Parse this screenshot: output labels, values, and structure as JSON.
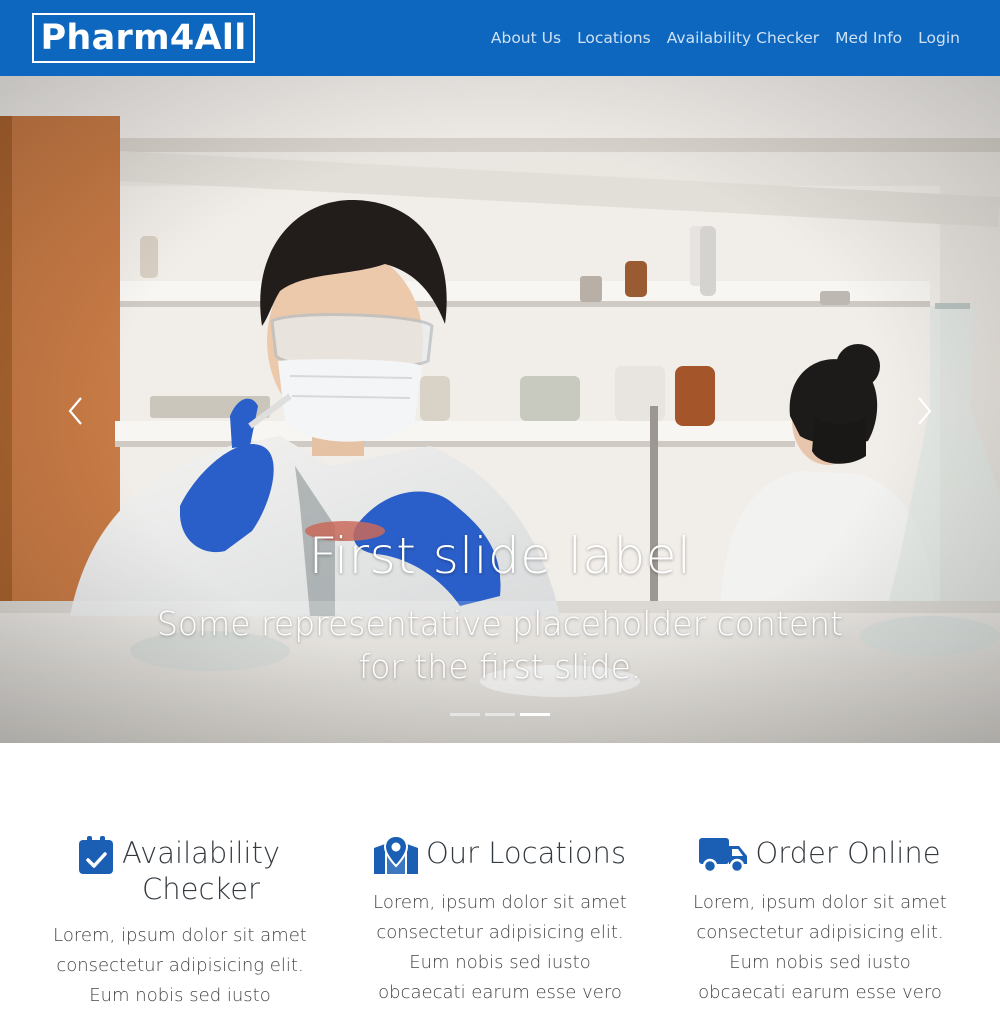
{
  "nav": {
    "brand": "Pharm4All",
    "links": [
      {
        "label": "About Us"
      },
      {
        "label": "Locations"
      },
      {
        "label": "Availability Checker"
      },
      {
        "label": "Med Info"
      },
      {
        "label": "Login"
      }
    ],
    "bg_color": "#0d67bf"
  },
  "carousel": {
    "slide_title": "First slide label",
    "slide_text": "Some representative placeholder content for the first slide.",
    "indicator_count": 3,
    "active_indicator": 3,
    "prev_icon": "chevron-left-icon",
    "next_icon": "chevron-right-icon"
  },
  "features": [
    {
      "icon": "calendar-check-icon",
      "title": "Availability Checker",
      "body": "Lorem, ipsum dolor sit amet consectetur adipisicing elit. Eum nobis sed iusto"
    },
    {
      "icon": "map-location-icon",
      "title": "Our Locations",
      "body": "Lorem, ipsum dolor sit amet consectetur adipisicing elit. Eum nobis sed iusto obcaecati earum esse vero"
    },
    {
      "icon": "truck-icon",
      "title": "Order Online",
      "body": "Lorem, ipsum dolor sit amet consectetur adipisicing elit. Eum nobis sed iusto obcaecati earum esse vero"
    }
  ],
  "colors": {
    "primary": "#0d67bf",
    "icon": "#1a5fb4"
  }
}
